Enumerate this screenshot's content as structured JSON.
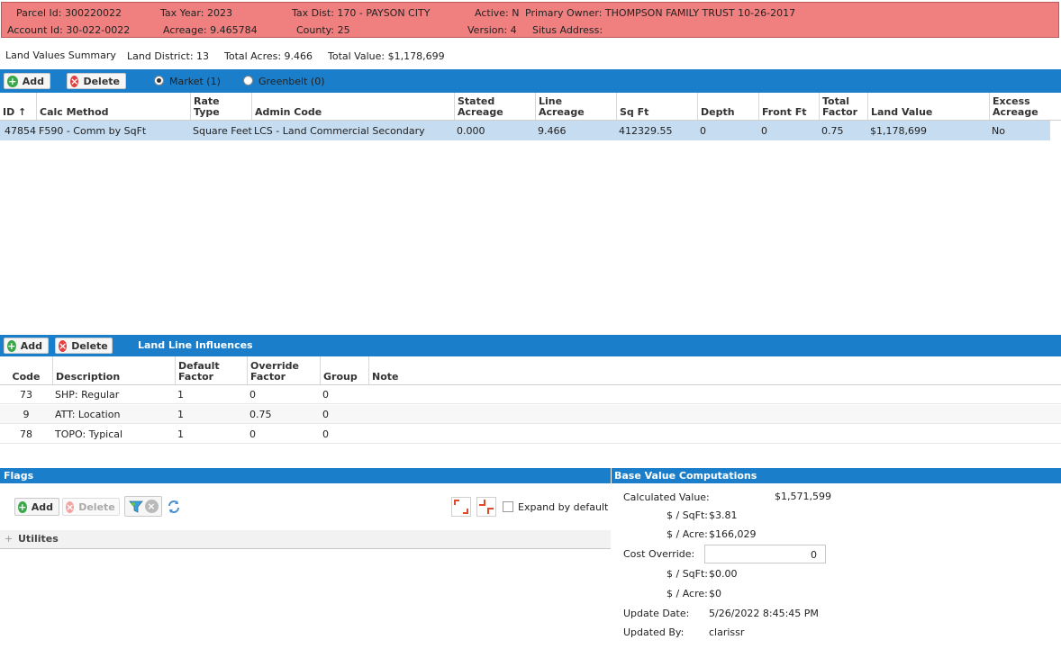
{
  "header": {
    "parcel_id": "Parcel Id: 300220022",
    "account_id": "Account Id: 30-022-0022",
    "tax_year": "Tax Year: 2023",
    "acreage": "Acreage: 9.465784",
    "tax_dist": "Tax Dist: 170 - PAYSON CITY",
    "county": "County: 25",
    "active": "Active: N",
    "version": "Version: 4",
    "primary_owner": "Primary Owner: THOMPSON FAMILY TRUST 10-26-2017",
    "situs_address": "Situs Address:"
  },
  "summary": {
    "title": "Land Values Summary",
    "land_district": "Land District: 13",
    "total_acres": "Total Acres: 9.466",
    "total_value": "Total Value: $1,178,699"
  },
  "land_toolbar": {
    "add": "Add",
    "delete": "Delete",
    "market": "Market (1)",
    "greenbelt": "Greenbelt (0)"
  },
  "land_grid": {
    "columns": [
      "ID ↑",
      "Calc Method",
      "Rate\nType",
      "Admin Code",
      "Stated\nAcreage",
      "Line\nAcreage",
      "Sq Ft",
      "Depth",
      "Front Ft",
      "Total\nFactor",
      "Land Value",
      "Excess\nAcreage"
    ],
    "rows": [
      [
        "47854",
        "F590 - Comm by SqFt",
        "Square Feet",
        "LCS - Land Commercial Secondary",
        "0.000",
        "9.466",
        "412329.55",
        "0",
        "0",
        "0.75",
        "$1,178,699",
        "No"
      ]
    ]
  },
  "influence_toolbar": {
    "add": "Add",
    "delete": "Delete",
    "title": "Land Line Influences"
  },
  "influence_grid": {
    "columns": [
      "Code",
      "Description",
      "Default\nFactor",
      "Override\nFactor",
      "Group",
      "Note"
    ],
    "rows": [
      [
        "73",
        "SHP: Regular",
        "1",
        "0",
        "0",
        ""
      ],
      [
        "9",
        "ATT: Location",
        "1",
        "0.75",
        "0",
        ""
      ],
      [
        "78",
        "TOPO: Typical",
        "1",
        "0",
        "0",
        ""
      ]
    ]
  },
  "flags": {
    "title": "Flags",
    "add": "Add",
    "delete": "Delete",
    "expand_label": "Expand by default",
    "group": "Utilites"
  },
  "base_value": {
    "title": "Base Value Computations",
    "calculated_value_label": "Calculated Value:",
    "calculated_value": "$1,571,599",
    "sqft_label_1": "$ / SqFt:",
    "sqft_value_1": "$3.81",
    "acre_label_1": "$ / Acre:",
    "acre_value_1": "$166,029",
    "cost_override_label": "Cost Override:",
    "cost_override_value": "0",
    "sqft_label_2": "$ / SqFt:",
    "sqft_value_2": "$0.00",
    "acre_label_2": "$ / Acre:",
    "acre_value_2": "$0",
    "update_date_label": "Update Date:",
    "update_date": "5/26/2022 8:45:45 PM",
    "updated_by_label": "Updated By:",
    "updated_by": "clarissr"
  },
  "colors": {
    "header_bg": "#f08080",
    "toolbar_blue": "#1a7ecb",
    "selected_row": "#c6dcf0"
  }
}
